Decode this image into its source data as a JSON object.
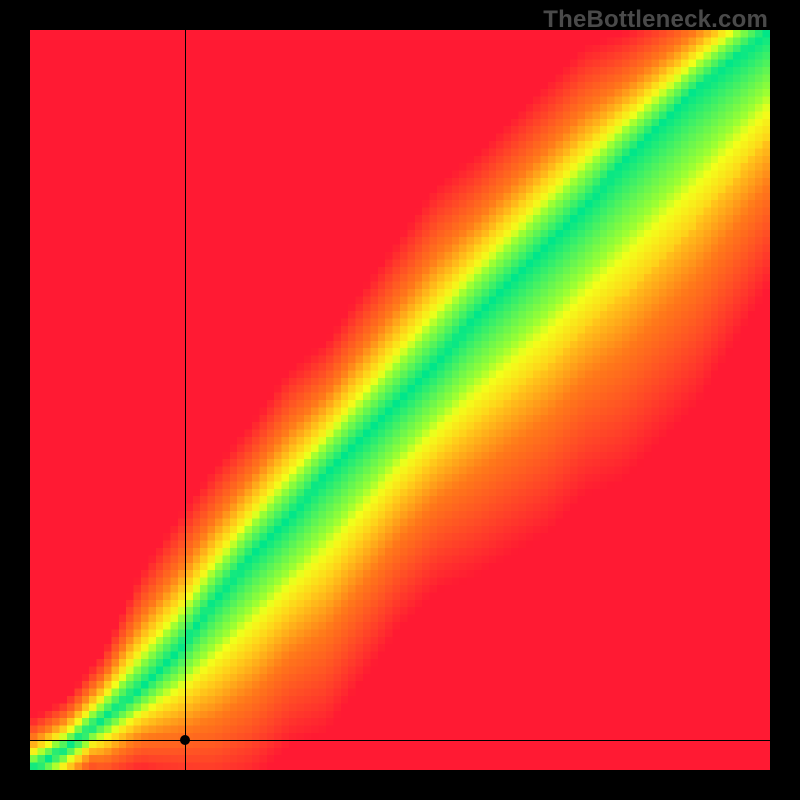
{
  "watermark": "TheBottleneck.com",
  "chart_data": {
    "type": "heatmap",
    "title": "",
    "xlabel": "",
    "ylabel": "",
    "xlim": [
      0,
      1
    ],
    "ylim": [
      0,
      1
    ],
    "grid": false,
    "legend": false,
    "crosshair": {
      "x": 0.21,
      "y": 0.04
    },
    "curves": [
      {
        "name": "center",
        "points": [
          [
            0.0,
            0.0
          ],
          [
            0.05,
            0.03
          ],
          [
            0.1,
            0.07
          ],
          [
            0.15,
            0.11
          ],
          [
            0.2,
            0.16
          ],
          [
            0.25,
            0.23
          ],
          [
            0.3,
            0.29
          ],
          [
            0.35,
            0.34
          ],
          [
            0.4,
            0.4
          ],
          [
            0.45,
            0.45
          ],
          [
            0.5,
            0.5
          ],
          [
            0.55,
            0.55
          ],
          [
            0.6,
            0.61
          ],
          [
            0.65,
            0.66
          ],
          [
            0.7,
            0.71
          ],
          [
            0.75,
            0.76
          ],
          [
            0.8,
            0.82
          ],
          [
            0.85,
            0.87
          ],
          [
            0.9,
            0.92
          ],
          [
            0.95,
            0.96
          ],
          [
            1.0,
            1.0
          ]
        ]
      },
      {
        "name": "upper_edge",
        "points": [
          [
            0.0,
            0.0
          ],
          [
            0.1,
            0.09
          ],
          [
            0.2,
            0.2
          ],
          [
            0.25,
            0.27
          ],
          [
            0.3,
            0.33
          ],
          [
            0.4,
            0.44
          ],
          [
            0.5,
            0.55
          ],
          [
            0.6,
            0.66
          ],
          [
            0.7,
            0.76
          ],
          [
            0.8,
            0.86
          ],
          [
            0.9,
            0.95
          ],
          [
            1.0,
            1.03
          ]
        ]
      },
      {
        "name": "lower_edge",
        "points": [
          [
            0.0,
            0.0
          ],
          [
            0.1,
            0.05
          ],
          [
            0.2,
            0.12
          ],
          [
            0.3,
            0.22
          ],
          [
            0.4,
            0.32
          ],
          [
            0.5,
            0.43
          ],
          [
            0.6,
            0.53
          ],
          [
            0.7,
            0.62
          ],
          [
            0.8,
            0.72
          ],
          [
            0.9,
            0.82
          ],
          [
            1.0,
            0.92
          ]
        ]
      }
    ],
    "color_scale": [
      {
        "stop": 0.0,
        "color": "#ff1a33"
      },
      {
        "stop": 0.4,
        "color": "#ff7a1a"
      },
      {
        "stop": 0.6,
        "color": "#ffd21a"
      },
      {
        "stop": 0.78,
        "color": "#f4ff1a"
      },
      {
        "stop": 0.9,
        "color": "#9cff33"
      },
      {
        "stop": 1.0,
        "color": "#00e68a"
      }
    ],
    "meaning": "Value at (x,y) measures bottleneck match; green ridge ≈ balanced pairing, red = severe bottleneck."
  }
}
